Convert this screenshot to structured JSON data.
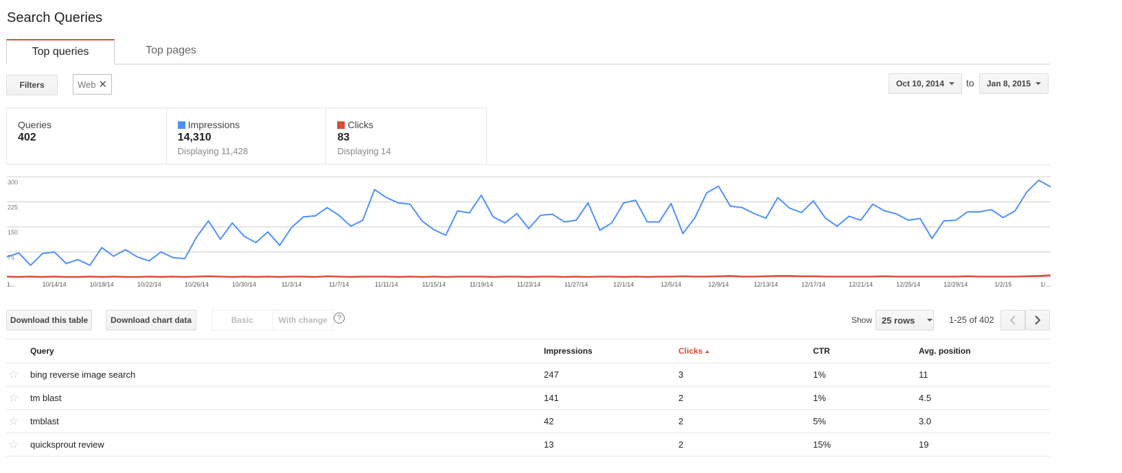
{
  "page_title": "Search Queries",
  "tabs": [
    {
      "label": "Top queries",
      "active": true
    },
    {
      "label": "Top pages",
      "active": false
    }
  ],
  "toolbar": {
    "filters_label": "Filters",
    "filter_chip": "Web",
    "date_from": "Oct 10, 2014",
    "date_to_label": "to",
    "date_to": "Jan 8, 2015"
  },
  "summary": {
    "queries": {
      "label": "Queries",
      "value": "402"
    },
    "impressions": {
      "label": "Impressions",
      "value": "14,310",
      "sub": "Displaying 11,428",
      "color": "#4d90fe"
    },
    "clicks": {
      "label": "Clicks",
      "value": "83",
      "sub": "Displaying 14",
      "color": "#dd4b39"
    }
  },
  "chart_data": {
    "type": "line",
    "ylim": [
      0,
      300
    ],
    "yticks": [
      "300",
      "225",
      "150",
      "75"
    ],
    "xticks": [
      "1...",
      "10/14/14",
      "10/18/14",
      "10/22/14",
      "10/26/14",
      "10/30/14",
      "11/3/14",
      "11/7/14",
      "11/11/14",
      "11/15/14",
      "11/19/14",
      "11/23/14",
      "11/27/14",
      "12/1/14",
      "12/5/14",
      "12/9/14",
      "12/13/14",
      "12/17/14",
      "12/21/14",
      "12/25/14",
      "12/29/14",
      "1/2/15",
      "1/..."
    ],
    "series": [
      {
        "name": "Impressions",
        "color": "#4d90fe",
        "values": [
          60,
          72,
          35,
          70,
          75,
          40,
          52,
          35,
          88,
          62,
          82,
          60,
          48,
          75,
          58,
          55,
          120,
          168,
          113,
          162,
          122,
          103,
          135,
          95,
          148,
          180,
          183,
          208,
          185,
          152,
          170,
          262,
          238,
          222,
          218,
          168,
          142,
          125,
          198,
          192,
          245,
          180,
          162,
          190,
          145,
          185,
          188,
          165,
          170,
          222,
          140,
          162,
          222,
          230,
          165,
          165,
          220,
          130,
          177,
          252,
          272,
          212,
          208,
          190,
          176,
          238,
          206,
          193,
          228,
          177,
          152,
          182,
          170,
          218,
          198,
          189,
          170,
          175,
          115,
          168,
          170,
          195,
          195,
          202,
          178,
          198,
          255,
          290,
          270
        ],
        "x": [
          "10/10/14",
          "10/11/14",
          "10/12/14",
          "10/13/14",
          "10/14/14",
          "10/15/14",
          "10/16/14",
          "10/17/14",
          "10/18/14",
          "10/19/14",
          "10/20/14",
          "10/21/14",
          "10/22/14",
          "10/23/14",
          "10/24/14",
          "10/25/14",
          "10/26/14",
          "10/27/14",
          "10/28/14",
          "10/29/14",
          "10/30/14",
          "10/31/14",
          "11/1/14",
          "11/2/14",
          "11/3/14",
          "11/4/14",
          "11/5/14",
          "11/6/14",
          "11/7/14",
          "11/8/14",
          "11/9/14",
          "11/10/14",
          "11/11/14",
          "11/12/14",
          "11/13/14",
          "11/14/14",
          "11/15/14",
          "11/16/14",
          "11/17/14",
          "11/18/14",
          "11/19/14",
          "11/20/14",
          "11/21/14",
          "11/22/14",
          "11/23/14",
          "11/24/14",
          "11/25/14",
          "11/26/14",
          "11/27/14",
          "11/28/14",
          "11/29/14",
          "11/30/14",
          "12/1/14",
          "12/2/14",
          "12/3/14",
          "12/4/14",
          "12/5/14",
          "12/6/14",
          "12/7/14",
          "12/8/14",
          "12/9/14",
          "12/10/14",
          "12/11/14",
          "12/12/14",
          "12/13/14",
          "12/14/14",
          "12/15/14",
          "12/16/14",
          "12/17/14",
          "12/18/14",
          "12/19/14",
          "12/20/14",
          "12/21/14",
          "12/22/14",
          "12/23/14",
          "12/24/14",
          "12/25/14",
          "12/26/14",
          "12/27/14",
          "12/28/14",
          "12/29/14",
          "12/30/14",
          "12/31/14",
          "1/1/15",
          "1/2/15",
          "1/3/15",
          "1/4/15",
          "1/5/15",
          "1/6/15"
        ]
      },
      {
        "name": "Clicks",
        "color": "#dd4b39",
        "values": [
          1,
          0,
          1,
          0,
          1,
          0,
          0,
          1,
          0,
          1,
          0,
          0,
          1,
          0,
          1,
          0,
          1,
          2,
          1,
          0,
          1,
          0,
          1,
          0,
          1,
          1,
          0,
          2,
          1,
          0,
          1,
          1,
          1,
          0,
          1,
          0,
          1,
          0,
          1,
          1,
          1,
          0,
          1,
          1,
          0,
          1,
          1,
          0,
          1,
          0,
          1,
          1,
          0,
          1,
          0,
          1,
          1,
          2,
          1,
          1,
          2,
          3,
          1,
          1,
          2,
          3,
          3,
          2,
          2,
          1,
          1,
          1,
          1,
          1,
          2,
          1,
          1,
          1,
          1,
          1,
          1,
          2,
          1,
          1,
          1,
          1,
          2,
          3,
          5
        ]
      }
    ]
  },
  "table_controls": {
    "download_table": "Download this table",
    "download_chart": "Download chart data",
    "basic": "Basic",
    "with_change": "With change",
    "help": "?",
    "show_label": "Show",
    "rows_value": "25 rows",
    "range": "1-25 of 402"
  },
  "table": {
    "headers": {
      "query": "Query",
      "impressions": "Impressions",
      "clicks": "Clicks",
      "ctr": "CTR",
      "avg_position": "Avg. position"
    },
    "rows": [
      {
        "query": "bing reverse image search",
        "impressions": "247",
        "clicks": "3",
        "ctr": "1%",
        "avg_position": "11"
      },
      {
        "query": "tm blast",
        "impressions": "141",
        "clicks": "2",
        "ctr": "1%",
        "avg_position": "4.5"
      },
      {
        "query": "tmblast",
        "impressions": "42",
        "clicks": "2",
        "ctr": "5%",
        "avg_position": "3.0"
      },
      {
        "query": "quicksprout review",
        "impressions": "13",
        "clicks": "2",
        "ctr": "15%",
        "avg_position": "19"
      }
    ]
  }
}
